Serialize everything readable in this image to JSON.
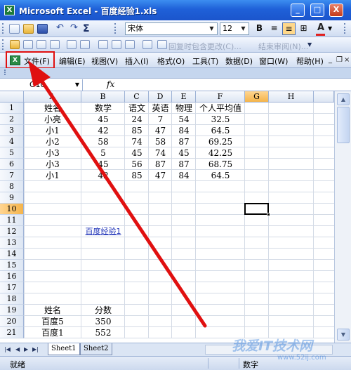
{
  "window": {
    "title": "Microsoft Excel - 百度经验1.xls",
    "app_icon_glyph": "X",
    "buttons": {
      "minimize": "_",
      "restore": "□",
      "close": "X"
    }
  },
  "toolbar": {
    "font_name": "宋体",
    "font_size": "12",
    "bold_label": "B",
    "sigma_label": "Σ",
    "align_center_label": "≡",
    "font_color_label": "A",
    "font_color": "#e0201f"
  },
  "review_toolbar": {
    "reply_text": "回复时包含更改(C)...",
    "end_review_text": "结束审阅(N)..."
  },
  "menu": {
    "items": [
      "文件(F)",
      "编辑(E)",
      "视图(V)",
      "插入(I)",
      "格式(O)",
      "工具(T)",
      "数据(D)",
      "窗口(W)",
      "帮助(H)"
    ]
  },
  "formula_bar": {
    "name_box": "G10",
    "fx_label": "fx",
    "formula": ""
  },
  "sheet": {
    "columns": [
      "A",
      "B",
      "C",
      "D",
      "E",
      "F",
      "G",
      "H"
    ],
    "selected_column": "G",
    "rows": [
      "1",
      "2",
      "3",
      "4",
      "5",
      "6",
      "7",
      "8",
      "9",
      "10",
      "11",
      "12",
      "13",
      "14",
      "15",
      "16",
      "17",
      "18",
      "19",
      "20",
      "21"
    ],
    "selected_row": "10",
    "table1": {
      "headers": [
        "姓名",
        "数学",
        "语文",
        "英语",
        "物理",
        "个人平均值"
      ],
      "rows": [
        [
          "小亮",
          "45",
          "24",
          "7",
          "54",
          "32.5"
        ],
        [
          "小1",
          "42",
          "85",
          "47",
          "84",
          "64.5"
        ],
        [
          "小2",
          "58",
          "74",
          "58",
          "87",
          "69.25"
        ],
        [
          "小3",
          "5",
          "45",
          "74",
          "45",
          "42.25"
        ],
        [
          "小3",
          "45",
          "56",
          "87",
          "87",
          "68.75"
        ],
        [
          "小1",
          "42",
          "85",
          "47",
          "84",
          "64.5"
        ]
      ]
    },
    "hyperlink_cell": "百度经验1",
    "table2": {
      "headers": [
        "姓名",
        "分数"
      ],
      "rows": [
        [
          "百度5",
          "350"
        ],
        [
          "百度1",
          "552"
        ]
      ]
    }
  },
  "tabs": {
    "nav": [
      "|◀",
      "◀",
      "▶",
      "▶|"
    ],
    "sheets": [
      "Sheet1",
      "Sheet2"
    ]
  },
  "status": {
    "ready": "就绪",
    "num_lock": "数字"
  },
  "watermark": {
    "text": "我爱IT技术网",
    "url": "www.52ij.com"
  },
  "annotation_color": "#e01010"
}
